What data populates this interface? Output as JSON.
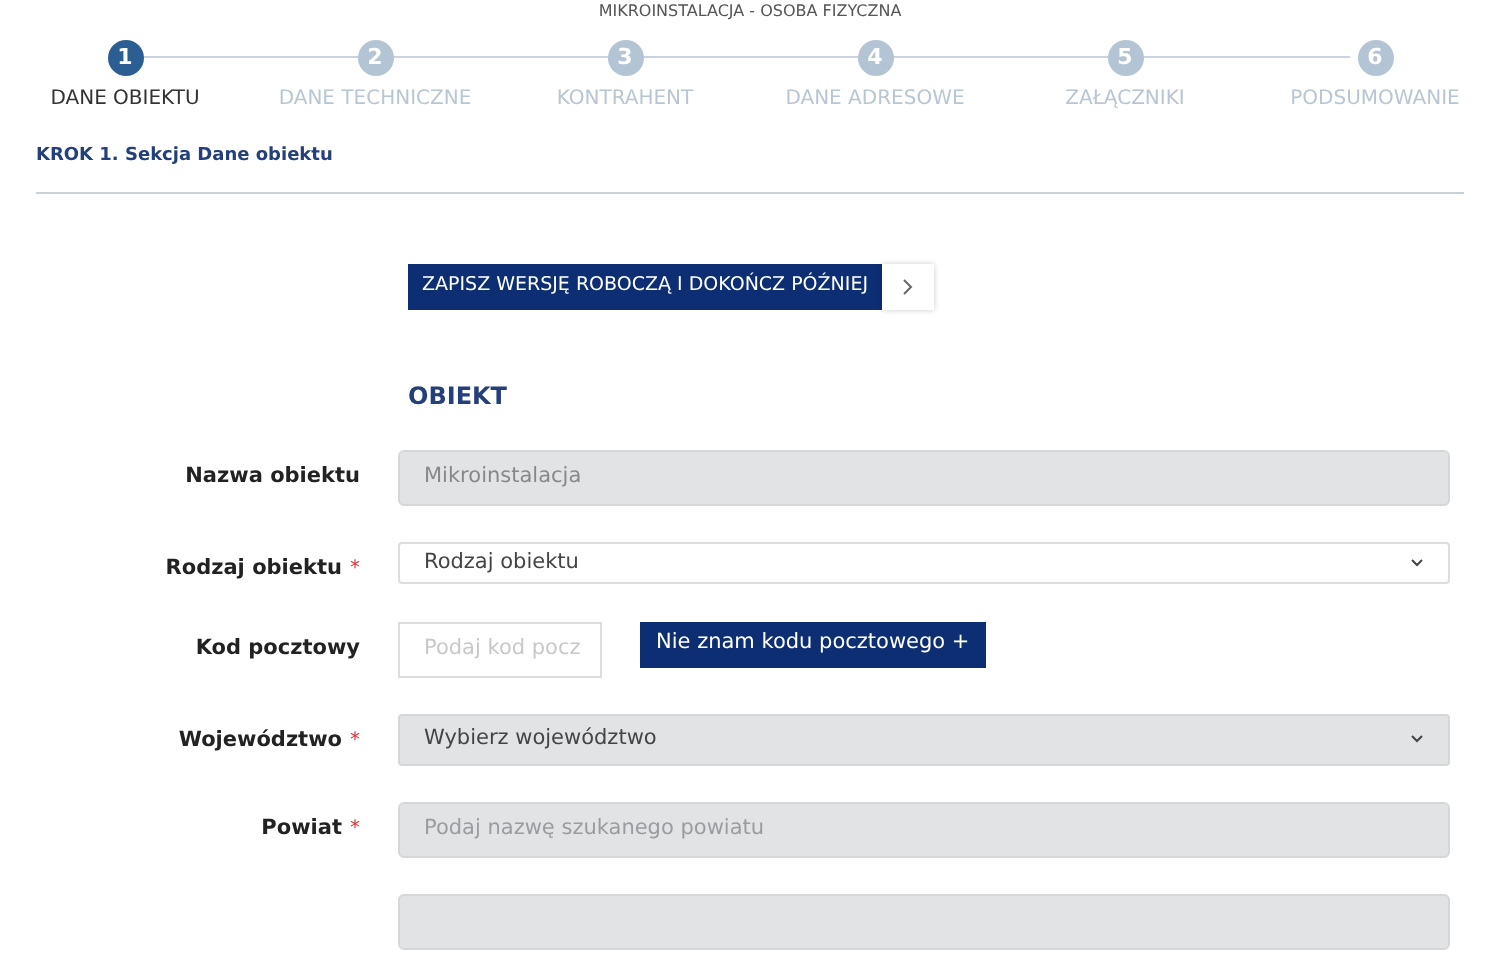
{
  "header": {
    "title": "MIKROINSTALACJA - OSOBA FIZYCZNA"
  },
  "steps": [
    {
      "number": "1",
      "label": "DANE OBIEKTU",
      "selected": true
    },
    {
      "number": "2",
      "label": "DANE TECHNICZNE",
      "selected": false
    },
    {
      "number": "3",
      "label": "KONTRAHENT",
      "selected": false
    },
    {
      "number": "4",
      "label": "DANE ADRESOWE",
      "selected": false
    },
    {
      "number": "5",
      "label": "ZAŁĄCZNIKI",
      "selected": false
    },
    {
      "number": "6",
      "label": "PODSUMOWANIE",
      "selected": false
    }
  ],
  "section_title": "KROK 1. Sekcja Dane obiektu",
  "save_draft_button": "ZAPISZ WERSJĘ ROBOCZĄ I DOKOŃCZ PÓŹNIEJ",
  "group_title": "OBIEKT",
  "fields": [
    {
      "kind": "input",
      "label": "Nazwa obiektu",
      "disabled": true,
      "value": "Mikroinstalacja"
    },
    {
      "kind": "select",
      "label": "Rodzaj obiektu",
      "required_mark": "*",
      "disabled": false,
      "value": "Rodzaj obiektu"
    },
    {
      "kind": "postcode",
      "label": "Kod pocztowy",
      "disabled": false,
      "placeholder": "Podaj kod pocz",
      "button": "Nie znam kodu pocztowego +"
    },
    {
      "kind": "select",
      "label": "Województwo",
      "required_mark": "*",
      "disabled": true,
      "value": "Wybierz województwo"
    },
    {
      "kind": "input",
      "label": "Powiat",
      "required_mark": "*",
      "disabled": true,
      "placeholder": "Podaj nazwę szukanego powiatu"
    },
    {
      "kind": "input",
      "disabled": true
    }
  ]
}
